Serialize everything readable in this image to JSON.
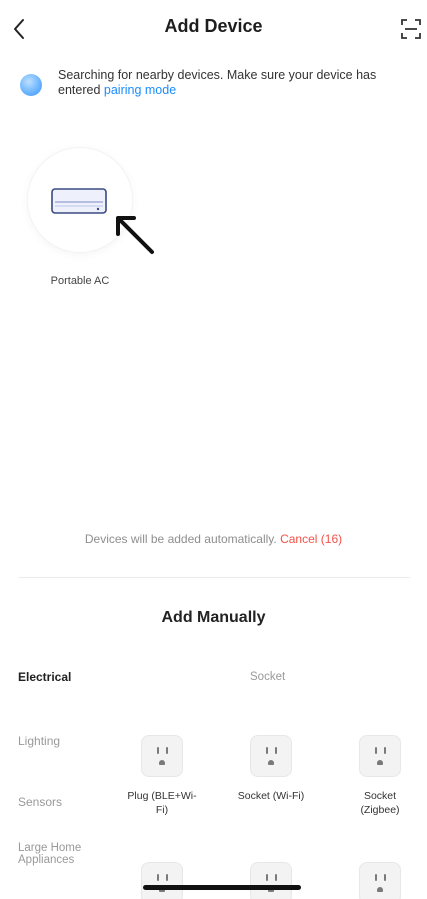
{
  "header": {
    "title": "Add Device",
    "back_icon": "chevron-left-icon",
    "scan_icon": "scan-icon"
  },
  "search": {
    "icon": "searching-indicator-icon",
    "message": "Searching for nearby devices. Make sure your device has entered",
    "pairing_link": "pairing mode"
  },
  "found_device": {
    "name": "Portable AC",
    "icon": "portable-ac-icon"
  },
  "auto_add": {
    "message": "Devices will be added automatically.",
    "cancel_label": "Cancel (16)"
  },
  "manual": {
    "title": "Add Manually",
    "categories": [
      {
        "label": "Electrical",
        "active": true
      },
      {
        "label": "Lighting",
        "active": false
      },
      {
        "label": "Sensors",
        "active": false
      },
      {
        "label": "Large Home Appliances",
        "active": false
      }
    ],
    "section_title": "Socket",
    "products": [
      {
        "name": "Plug (BLE+Wi-Fi)",
        "icon": "plug-icon"
      },
      {
        "name": "Socket (Wi-Fi)",
        "icon": "plug-icon"
      },
      {
        "name": "Socket (Zigbee)",
        "icon": "plug-icon"
      },
      {
        "name": "",
        "icon": "plug-icon"
      },
      {
        "name": "",
        "icon": "plug-icon"
      },
      {
        "name": "",
        "icon": "plug-icon"
      }
    ]
  },
  "colors": {
    "accent_blue": "#1a8cff",
    "cancel_red": "#f2524a"
  }
}
